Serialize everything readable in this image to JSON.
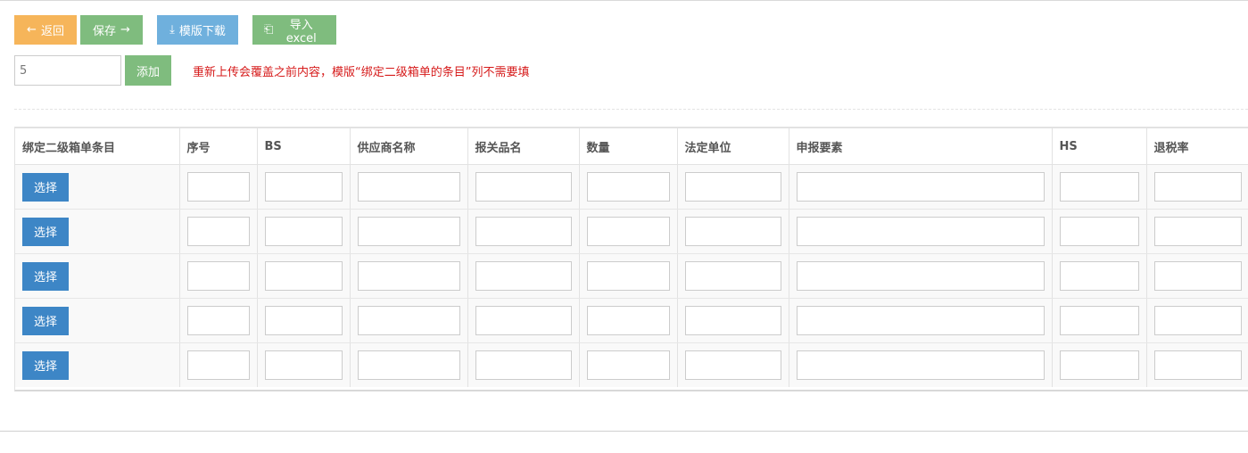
{
  "toolbar": {
    "back_label": "返回",
    "save_label": "保存",
    "download_label": "模版下载",
    "import_label": "导入excel"
  },
  "add_bar": {
    "quantity_value": "5",
    "add_label": "添加",
    "notice": "重新上传会覆盖之前内容，模版“绑定二级箱单的条目”列不需要填"
  },
  "table": {
    "columns": [
      "绑定二级箱单条目",
      "序号",
      "BS",
      "供应商名称",
      "报关品名",
      "数量",
      "法定单位",
      "申报要素",
      "HS",
      "退税率"
    ],
    "choose_label": "选择",
    "row_count": 5
  },
  "colors": {
    "back": "#f6b55a",
    "save": "#7fbc7e",
    "download": "#6fb0dd",
    "choose": "#3d86c6",
    "notice": "#d61a1a"
  }
}
